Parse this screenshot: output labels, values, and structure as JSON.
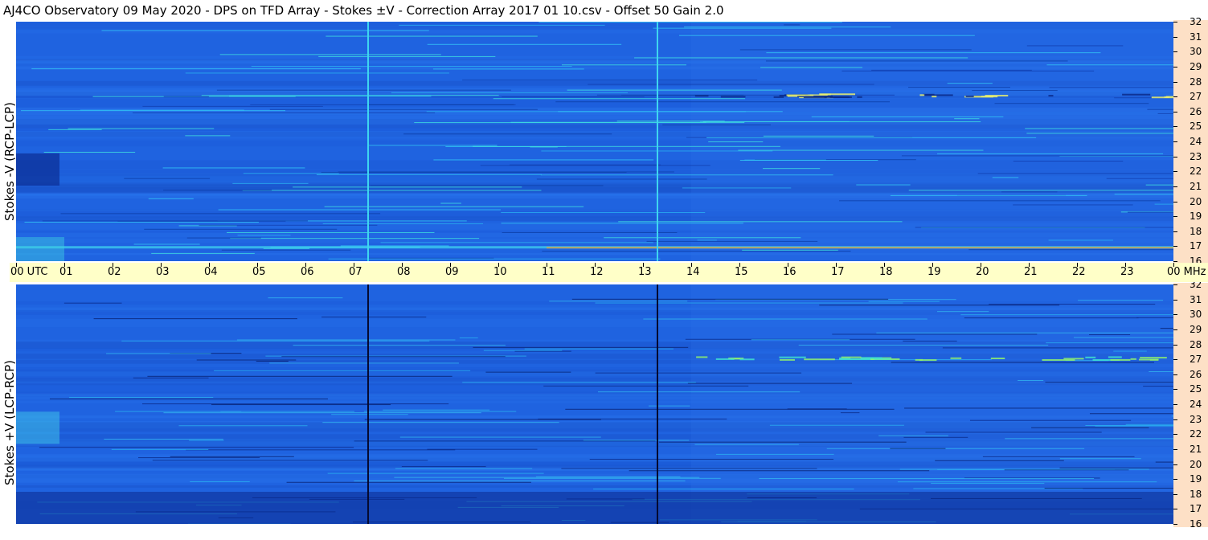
{
  "title": "AJ4CO Observatory  09 May 2020  -  DPS on TFD Array  -  Stokes ±V  -  Correction Array 2017 01 10.csv  -  Offset 50  Gain 2.0",
  "chart_data": [
    {
      "type": "heatmap",
      "panel": "top",
      "ylabel": "Stokes -V (RCP-LCP)",
      "x_axis": {
        "labels": [
          "00 UTC",
          "01",
          "02",
          "03",
          "04",
          "05",
          "06",
          "07",
          "08",
          "09",
          "10",
          "11",
          "12",
          "13",
          "14",
          "15",
          "16",
          "17",
          "18",
          "19",
          "20",
          "21",
          "22",
          "23",
          "00 MHz"
        ],
        "range_hours": [
          0,
          24
        ]
      },
      "y_axis": {
        "labels": [
          "16",
          "17",
          "18",
          "19",
          "20",
          "21",
          "22",
          "23",
          "24",
          "25",
          "26",
          "27",
          "28",
          "29",
          "30",
          "31",
          "32"
        ],
        "unit": "MHz",
        "range": [
          16,
          32
        ]
      },
      "features": {
        "bright_vertical_lines_hours": [
          7.3,
          13.3
        ],
        "dominant_color": "#1f63e0"
      }
    },
    {
      "type": "heatmap",
      "panel": "bottom",
      "ylabel": "Stokes +V (LCP-RCP)",
      "x_axis": {
        "range_hours": [
          0,
          24
        ]
      },
      "y_axis": {
        "labels": [
          "16",
          "17",
          "18",
          "19",
          "20",
          "21",
          "22",
          "23",
          "24",
          "25",
          "26",
          "27",
          "28",
          "29",
          "30",
          "31",
          "32"
        ],
        "unit": "MHz",
        "range": [
          16,
          32
        ]
      },
      "features": {
        "dark_vertical_lines_hours": [
          7.3,
          13.3
        ],
        "dominant_color": "#1f63e0"
      }
    }
  ],
  "colors": {
    "background_blue": "#1f63e0",
    "freq_strip": "#fde0c6",
    "utc_bar": "#ffffc8"
  }
}
